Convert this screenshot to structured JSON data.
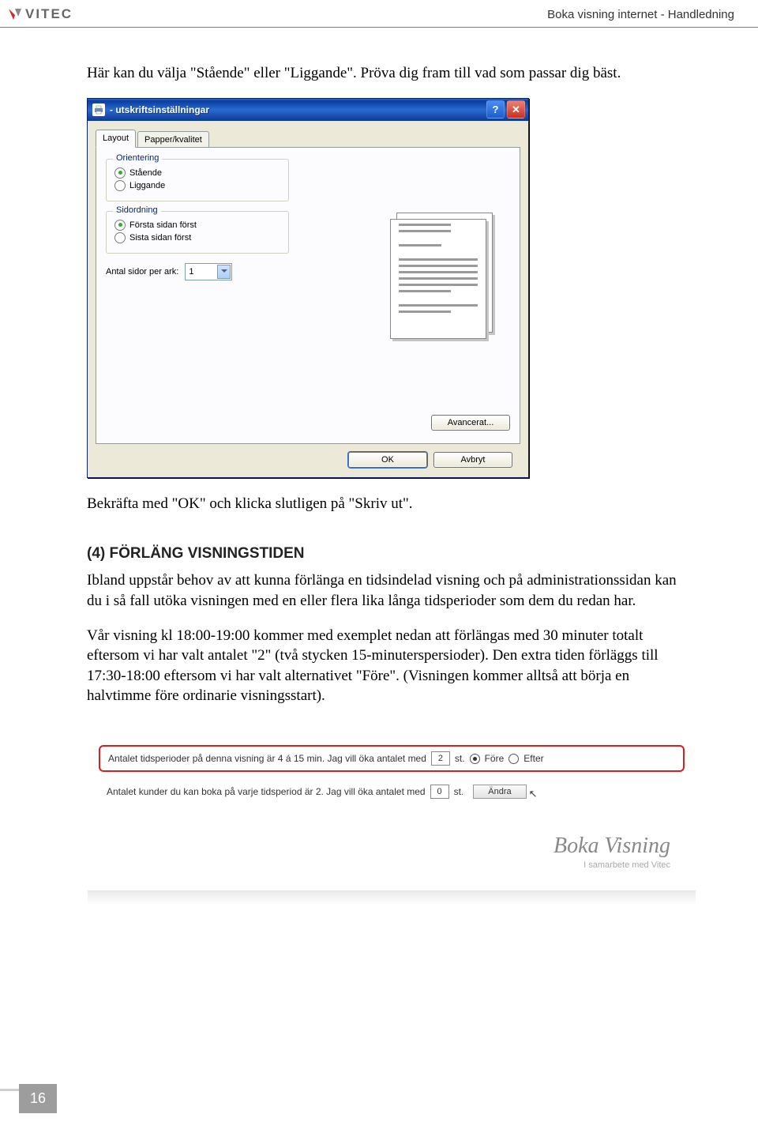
{
  "header": {
    "logo_text": "VITEC",
    "doc_title": "Boka visning internet - Handledning"
  },
  "body": {
    "p1": "Här kan du välja \"Stående\" eller \"Liggande\". Pröva dig fram till vad som passar dig bäst.",
    "p2": "Bekräfta med \"OK\" och klicka slutligen på \"Skriv ut\".",
    "section_title": "(4) FÖRLÄNG VISNINGSTIDEN",
    "p3": "Ibland uppstår behov av att kunna förlänga en tidsindelad visning och på administrationssidan kan du i så fall utöka visningen med en eller flera lika långa tidsperioder som dem du redan har.",
    "p4": "Vår visning kl 18:00-19:00 kommer med exemplet nedan att förlängas med 30 minuter totalt eftersom vi har valt antalet \"2\" (två stycken 15-minuterspersioder). Den extra tiden förläggs till 17:30-18:00 eftersom vi har valt alternativet \"Före\". (Visningen kommer alltså att börja en halvtimme före ordinarie visningsstart)."
  },
  "dialog": {
    "title": "- utskriftsinställningar",
    "tabs": {
      "layout": "Layout",
      "paper": "Papper/kvalitet"
    },
    "orientation": {
      "legend": "Orientering",
      "portrait": "Stående",
      "landscape": "Liggande"
    },
    "pageorder": {
      "legend": "Sidordning",
      "first": "Första sidan först",
      "last": "Sista sidan först"
    },
    "pages_per_sheet": {
      "label": "Antal sidor per ark:",
      "value": "1"
    },
    "advanced": "Avancerat...",
    "ok": "OK",
    "cancel": "Avbryt"
  },
  "webpanel": {
    "row1_a": "Antalet tidsperioder på denna visning är 4 á 15 min. Jag vill öka antalet med",
    "row1_val": "2",
    "row1_b": "st.",
    "before": "Före",
    "after": "Efter",
    "row2_a": "Antalet kunder du kan boka på varje tidsperiod är 2. Jag vill öka antalet med",
    "row2_val": "0",
    "row2_b": "st.",
    "change": "Ändra",
    "logo": "Boka Visning",
    "sub": "I samarbete med Vitec"
  },
  "page_number": "16"
}
